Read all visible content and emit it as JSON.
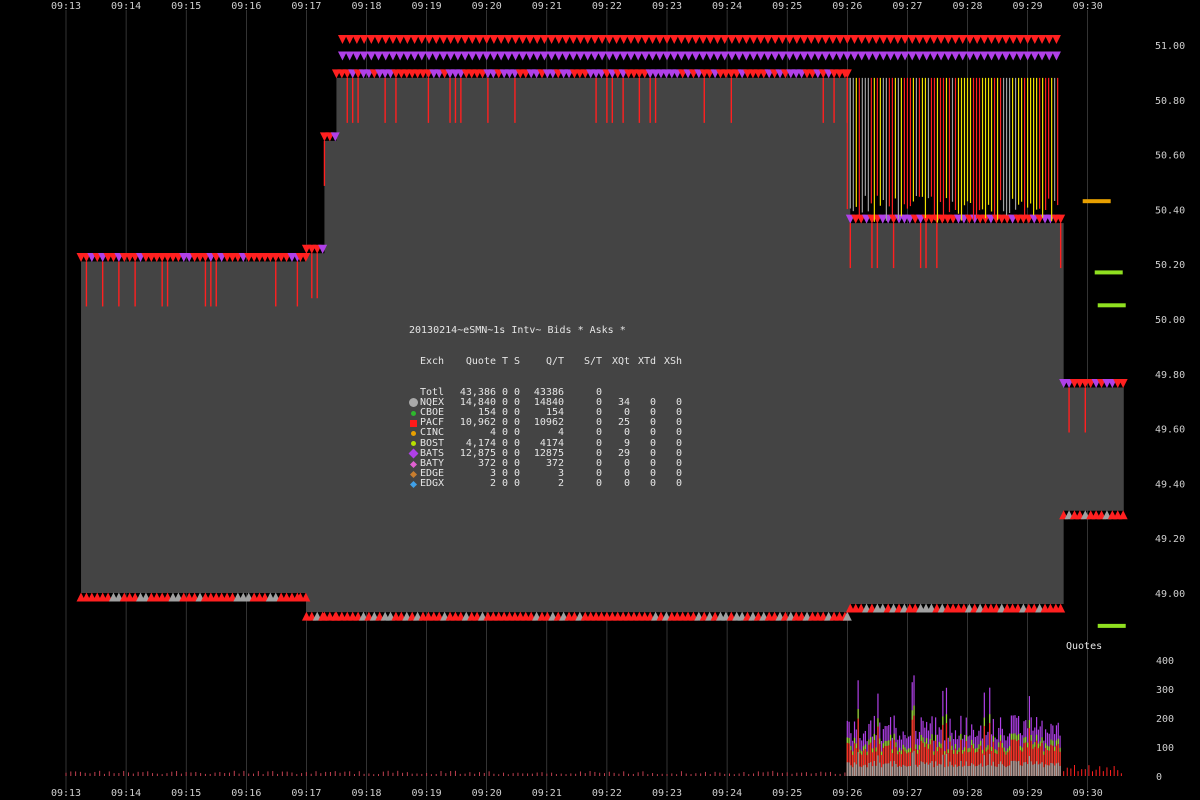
{
  "chart_data": {
    "type": "area",
    "title": "20130214~eSMN~1s Intv~ Bids * Asks *",
    "x_ticks": [
      "09:13",
      "09:14",
      "09:15",
      "09:16",
      "09:17",
      "09:18",
      "09:19",
      "09:20",
      "09:21",
      "09:22",
      "09:23",
      "09:24",
      "09:25",
      "09:26",
      "09:27",
      "09:28",
      "09:29",
      "09:30"
    ],
    "y_ticks": [
      "51.00",
      "50.80",
      "50.60",
      "50.40",
      "50.20",
      "50.00",
      "49.80",
      "49.60",
      "49.40",
      "49.20",
      "49.00"
    ],
    "ylim": [
      48.85,
      51.05
    ],
    "volume_label": "Quotes",
    "volume_ticks": [
      "400",
      "300",
      "200",
      "100",
      "0"
    ],
    "volume_ylim": [
      0,
      420
    ],
    "bid_ask": [
      {
        "t": 13.25,
        "ask": 50.21,
        "bid": 49.0
      },
      {
        "t": 16.9,
        "ask": 50.21,
        "bid": 49.0
      },
      {
        "t": 17.0,
        "ask": 50.24,
        "bid": 48.93
      },
      {
        "t": 17.3,
        "ask": 50.65,
        "bid": 48.93
      },
      {
        "t": 17.5,
        "ask": 50.88,
        "bid": 48.93
      },
      {
        "t": 26.0,
        "ask": 50.88,
        "bid": 48.93
      },
      {
        "t": 26.05,
        "ask": 50.35,
        "bid": 48.96
      },
      {
        "t": 29.55,
        "ask": 50.35,
        "bid": 48.96
      },
      {
        "t": 29.6,
        "ask": 49.75,
        "bid": 49.3
      },
      {
        "t": 30.6,
        "ask": 49.75,
        "bid": 49.35
      }
    ],
    "legend": {
      "header": [
        "Exch",
        "Quote",
        "T",
        "S",
        "Q/T",
        "S/T",
        "XQt",
        "XTd",
        "XSh"
      ],
      "rows": [
        {
          "exch": "Totl",
          "quote": "43,386",
          "t": "0",
          "s": "0",
          "qt": "43386",
          "st": "0",
          "xqt": "",
          "xtd": "",
          "xsh": "",
          "marker": "none",
          "color": ""
        },
        {
          "exch": "NQEX",
          "quote": "14,840",
          "t": "0",
          "s": "0",
          "qt": "14840",
          "st": "0",
          "xqt": "34",
          "xtd": "0",
          "xsh": "0",
          "marker": "circle",
          "color": "#a9a9a9"
        },
        {
          "exch": "CBOE",
          "quote": "154",
          "t": "0",
          "s": "0",
          "qt": "154",
          "st": "0",
          "xqt": "0",
          "xtd": "0",
          "xsh": "0",
          "marker": "dot",
          "color": "#2db82d"
        },
        {
          "exch": "PACF",
          "quote": "10,962",
          "t": "0",
          "s": "0",
          "qt": "10962",
          "st": "0",
          "xqt": "25",
          "xtd": "0",
          "xsh": "0",
          "marker": "square",
          "color": "#ff1a1a"
        },
        {
          "exch": "CINC",
          "quote": "4",
          "t": "0",
          "s": "0",
          "qt": "4",
          "st": "0",
          "xqt": "0",
          "xtd": "0",
          "xsh": "0",
          "marker": "dot",
          "color": "#e8a000"
        },
        {
          "exch": "BOST",
          "quote": "4,174",
          "t": "0",
          "s": "0",
          "qt": "4174",
          "st": "0",
          "xqt": "9",
          "xtd": "0",
          "xsh": "0",
          "marker": "dot",
          "color": "#b7e000"
        },
        {
          "exch": "BATS",
          "quote": "12,875",
          "t": "0",
          "s": "0",
          "qt": "12875",
          "st": "0",
          "xqt": "29",
          "xtd": "0",
          "xsh": "0",
          "marker": "diamond",
          "color": "#b040e8"
        },
        {
          "exch": "BATY",
          "quote": "372",
          "t": "0",
          "s": "0",
          "qt": "372",
          "st": "0",
          "xqt": "0",
          "xtd": "0",
          "xsh": "0",
          "marker": "diamond-s",
          "color": "#e060d0"
        },
        {
          "exch": "EDGE",
          "quote": "3",
          "t": "0",
          "s": "0",
          "qt": "3",
          "st": "0",
          "xqt": "0",
          "xtd": "0",
          "xsh": "0",
          "marker": "diamond-s",
          "color": "#c87d2e"
        },
        {
          "exch": "EDGX",
          "quote": "2",
          "t": "0",
          "s": "0",
          "qt": "2",
          "st": "0",
          "xqt": "0",
          "xtd": "0",
          "xsh": "0",
          "marker": "diamond-s",
          "color": "#3fa0e8"
        }
      ]
    },
    "colors": {
      "spread_fill": "#444444",
      "quote_red": "#ff2020",
      "quote_purple": "#b040e8",
      "quote_yellow": "#f0e000",
      "quote_gray": "#a0a0a0",
      "quote_green": "#90e020",
      "grid": "#555555"
    },
    "late_quotes": [
      {
        "t": 29.95,
        "price": 50.43,
        "color": "#e8a000"
      },
      {
        "t": 30.15,
        "price": 50.17,
        "color": "#90e020"
      },
      {
        "t": 30.2,
        "price": 50.05,
        "color": "#90e020"
      },
      {
        "t": 30.2,
        "price": 48.88,
        "color": "#90e020"
      }
    ]
  }
}
